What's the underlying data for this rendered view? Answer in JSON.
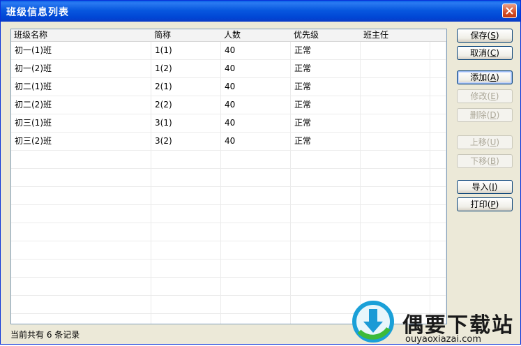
{
  "window": {
    "title": "班级信息列表"
  },
  "table": {
    "columns": [
      "班级名称",
      "简称",
      "人数",
      "优先级",
      "班主任"
    ],
    "rows": [
      [
        "初一(1)班",
        "1(1)",
        "40",
        "正常",
        ""
      ],
      [
        "初一(2)班",
        "1(2)",
        "40",
        "正常",
        ""
      ],
      [
        "初二(1)班",
        "2(1)",
        "40",
        "正常",
        ""
      ],
      [
        "初二(2)班",
        "2(2)",
        "40",
        "正常",
        ""
      ],
      [
        "初三(1)班",
        "3(1)",
        "40",
        "正常",
        ""
      ],
      [
        "初三(2)班",
        "3(2)",
        "40",
        "正常",
        ""
      ]
    ]
  },
  "buttons": {
    "save": {
      "label": "保存",
      "key": "S"
    },
    "cancel": {
      "label": "取消",
      "key": "C"
    },
    "add": {
      "label": "添加",
      "key": "A"
    },
    "edit": {
      "label": "修改",
      "key": "E"
    },
    "delete": {
      "label": "删除",
      "key": "D"
    },
    "move_up": {
      "label": "上移",
      "key": "U"
    },
    "move_down": {
      "label": "下移",
      "key": "B"
    },
    "import": {
      "label": "导入",
      "key": "I"
    },
    "print": {
      "label": "打印",
      "key": "P"
    }
  },
  "status": {
    "text": "当前共有 6 条记录"
  },
  "watermark": {
    "name": "偶要下载站",
    "url": "ouyaoxiazai.com"
  },
  "colors": {
    "titlebar": "#0054e3",
    "close": "#d5502a",
    "grid_border": "#7f9db9"
  }
}
